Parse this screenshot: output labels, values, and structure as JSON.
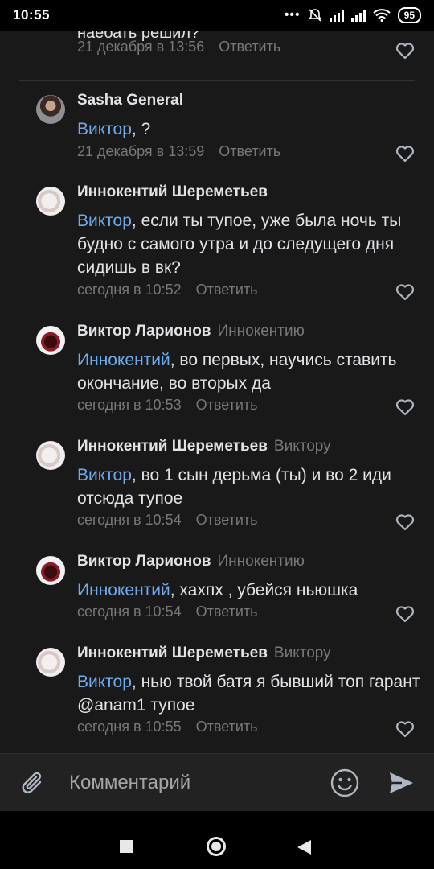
{
  "status_bar": {
    "time": "10:55",
    "battery": "95"
  },
  "partial_comment": {
    "text": "наебать решил?",
    "date": "21 декабря в 13:56",
    "reply_label": "Ответить"
  },
  "comments": [
    {
      "author": "Sasha General",
      "reply_to": "",
      "mention": "Виктор",
      "text": ", ?",
      "date": "21 декабря в 13:59",
      "reply_label": "Ответить"
    },
    {
      "author": "Иннокентий Шереметьев",
      "reply_to": "",
      "mention": "Виктор",
      "text": ", если ты тупое, уже была ночь ты будно с самого утра и до следущего дня сидишь в вк?",
      "date": "сегодня в 10:52",
      "reply_label": "Ответить"
    },
    {
      "author": "Виктор Ларионов",
      "reply_to": "Иннокентию",
      "mention": "Иннокентий",
      "text": ", во первых, научись ставить окончание, во вторых да",
      "date": "сегодня в 10:53",
      "reply_label": "Ответить"
    },
    {
      "author": "Иннокентий Шереметьев",
      "reply_to": "Виктору",
      "mention": "Виктор",
      "text": ", во 1 сын дерьма (ты) и во 2 иди отсюда тупое",
      "date": "сегодня в 10:54",
      "reply_label": "Ответить"
    },
    {
      "author": "Виктор Ларионов",
      "reply_to": "Иннокентию",
      "mention": "Иннокентий",
      "text": ", хахпх , убейся ньюшка",
      "date": "сегодня в 10:54",
      "reply_label": "Ответить"
    },
    {
      "author": "Иннокентий Шереметьев",
      "reply_to": "Виктору",
      "mention": "Виктор",
      "text": ", нью твой батя я бывший топ гарант @anam1 тупое",
      "date": "сегодня в 10:55",
      "reply_label": "Ответить"
    }
  ],
  "composer": {
    "placeholder": "Комментарий"
  },
  "colors": {
    "background": "#19191a",
    "link": "#71aaeb",
    "secondary_text": "#76787a",
    "primary_text": "#e1e3e6"
  }
}
